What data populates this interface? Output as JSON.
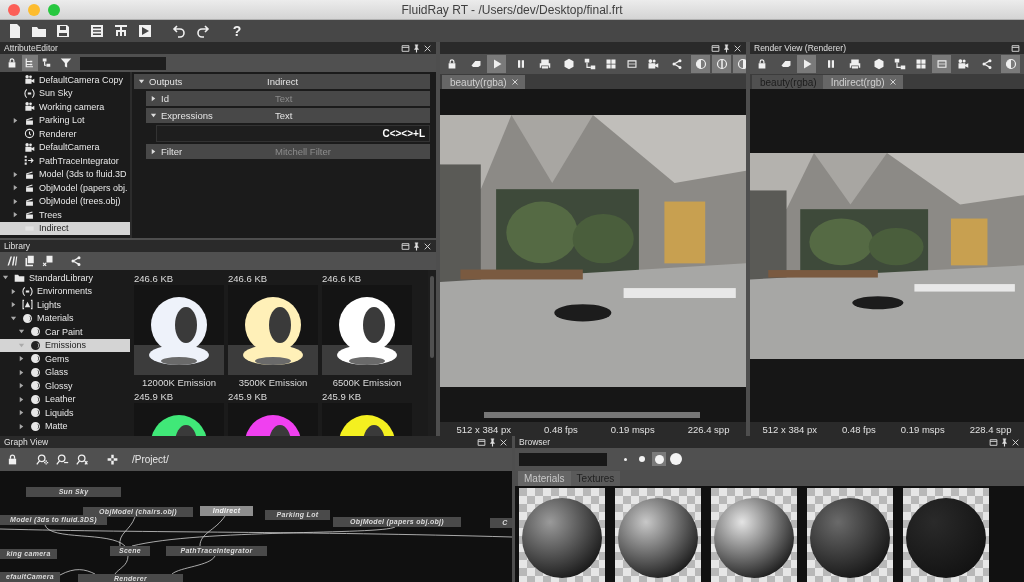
{
  "window": {
    "title": "FluidRay RT - /Users/dev/Desktop/final.frt"
  },
  "toolbar": {
    "help_label": "?"
  },
  "attribute_editor": {
    "title": "AttributeEditor",
    "toolbar": [
      {
        "on": false
      },
      {
        "on": true
      },
      {
        "on": false
      },
      {
        "on": false
      }
    ],
    "tree": [
      {
        "label": "DefaultCamera Copy",
        "kind": "camera",
        "expandable": false,
        "selected": false
      },
      {
        "label": "Sun Sky",
        "kind": "sky",
        "expandable": false,
        "selected": false
      },
      {
        "label": "Working camera",
        "kind": "camera",
        "expandable": false,
        "selected": false
      },
      {
        "label": "Parking Lot",
        "kind": "model",
        "expandable": true,
        "selected": false
      },
      {
        "label": "Renderer",
        "kind": "renderer",
        "expandable": false,
        "selected": false
      },
      {
        "label": "DefaultCamera",
        "kind": "camera",
        "expandable": false,
        "selected": false
      },
      {
        "label": "PathTraceIntegrator",
        "kind": "integrator",
        "expandable": false,
        "selected": false
      },
      {
        "label": "Model (3ds to fluid.3D",
        "kind": "model",
        "expandable": true,
        "selected": false
      },
      {
        "label": "ObjModel (papers obj.",
        "kind": "model",
        "expandable": true,
        "selected": false
      },
      {
        "label": "ObjModel (trees.obj)",
        "kind": "model",
        "expandable": true,
        "selected": false
      },
      {
        "label": "Trees",
        "kind": "model",
        "expandable": true,
        "selected": false
      },
      {
        "label": "Indirect",
        "kind": "output",
        "expandable": false,
        "selected": true
      }
    ],
    "properties": [
      {
        "kind": "group",
        "label": "Outputs",
        "value": "Indirect",
        "expanded": true,
        "children": [
          {
            "kind": "group",
            "label": "Id",
            "value": "Text",
            "expanded": false
          },
          {
            "kind": "group",
            "label": "Expressions",
            "value": "Text",
            "expanded": true,
            "children": [
              {
                "kind": "field",
                "value": "C<><>+L"
              }
            ]
          },
          {
            "kind": "group",
            "label": "Filter",
            "value": "Mitchell Filter",
            "expanded": false
          }
        ]
      }
    ]
  },
  "library": {
    "title": "Library",
    "tree": [
      {
        "label": "StandardLibrary",
        "kind": "folder",
        "expanded": true,
        "selected": false,
        "children": [
          {
            "label": "Environments",
            "kind": "sky",
            "expanded": false,
            "selected": false
          },
          {
            "label": "Lights",
            "kind": "light",
            "expanded": false,
            "selected": false
          },
          {
            "label": "Materials",
            "kind": "material",
            "expanded": true,
            "selected": false,
            "children": [
              {
                "label": "Car Paint",
                "kind": "material",
                "expanded": true,
                "selected": false
              },
              {
                "label": "Emissions",
                "kind": "material",
                "expanded": true,
                "selected": true
              },
              {
                "label": "Gems",
                "kind": "material",
                "expanded": false,
                "selected": false
              },
              {
                "label": "Glass",
                "kind": "material",
                "expanded": false,
                "selected": false
              },
              {
                "label": "Glossy",
                "kind": "material",
                "expanded": false,
                "selected": false
              },
              {
                "label": "Leather",
                "kind": "material",
                "expanded": false,
                "selected": false
              },
              {
                "label": "Liquids",
                "kind": "material",
                "expanded": false,
                "selected": false
              },
              {
                "label": "Matte",
                "kind": "material",
                "expanded": false,
                "selected": false
              }
            ]
          }
        ]
      }
    ],
    "items": [
      {
        "size": "246.6 KB",
        "label": "12000K Emission",
        "color": "#eef2fa"
      },
      {
        "size": "246.6 KB",
        "label": "3500K Emission",
        "color": "#fff0b8"
      },
      {
        "size": "246.6 KB",
        "label": "6500K Emission",
        "color": "#ffffff"
      },
      {
        "size": "245.9 KB",
        "color": "#40e878"
      },
      {
        "size": "245.9 KB",
        "color": "#f040f0"
      },
      {
        "size": "245.9 KB",
        "color": "#f4f020"
      }
    ]
  },
  "render_views": [
    {
      "toolbar": [
        {
          "on": false
        },
        {
          "on": false
        },
        {
          "on": true
        },
        {
          "on": false
        },
        {
          "on": false
        },
        {
          "on": false
        },
        {
          "on": false
        },
        {
          "on": false
        },
        {
          "on": false
        },
        {
          "on": false
        },
        {
          "on": false
        },
        {
          "on": true
        },
        {
          "on": true
        },
        {
          "on": true
        }
      ],
      "tabs": [
        {
          "label": "beauty(rgba)",
          "selected": true,
          "closable": true
        }
      ],
      "status": [
        "512 x 384 px",
        "0.48 fps",
        "0.19 msps",
        "226.4 spp"
      ]
    },
    {
      "title": "Render View (Renderer)",
      "toolbar": [
        {
          "on": false
        },
        {
          "on": false
        },
        {
          "on": true
        },
        {
          "on": false
        },
        {
          "on": false
        },
        {
          "on": false
        },
        {
          "on": false
        },
        {
          "on": false
        },
        {
          "on": true
        },
        {
          "on": false
        },
        {
          "on": false
        },
        {
          "on": true
        }
      ],
      "tabs": [
        {
          "label": "beauty(rgba)",
          "selected": false,
          "closable": false
        },
        {
          "label": "Indirect(rgb)",
          "selected": true,
          "closable": true
        }
      ],
      "status": [
        "512 x 384 px",
        "0.48 fps",
        "0.19 msps",
        "228.4 spp"
      ]
    }
  ],
  "graph_view": {
    "title": "Graph View",
    "path": "/Project/",
    "nodes": [
      {
        "label": "Sun Sky",
        "selected": false
      },
      {
        "label": "Model (3ds to fluid.3DS)",
        "selected": false
      },
      {
        "label": "ObjModel (chairs.obj)",
        "selected": false
      },
      {
        "label": "Indirect",
        "selected": true
      },
      {
        "label": "Parking Lot",
        "selected": false
      },
      {
        "label": "ObjModel (papers obj.obj)",
        "selected": false
      },
      {
        "label": "C",
        "selected": false
      },
      {
        "label": "king camera",
        "selected": false
      },
      {
        "label": "Scene",
        "selected": false
      },
      {
        "label": "PathTraceIntegrator",
        "selected": false
      },
      {
        "label": "efaultCamera",
        "selected": false
      },
      {
        "label": "Renderer",
        "selected": false
      }
    ]
  },
  "browser": {
    "title": "Browser",
    "sizes": [
      {
        "selected": false
      },
      {
        "selected": false
      },
      {
        "selected": true
      },
      {
        "selected": false
      }
    ],
    "tabs": [
      {
        "label": "Materials",
        "selected": true
      },
      {
        "label": "Textures",
        "selected": false
      }
    ]
  }
}
